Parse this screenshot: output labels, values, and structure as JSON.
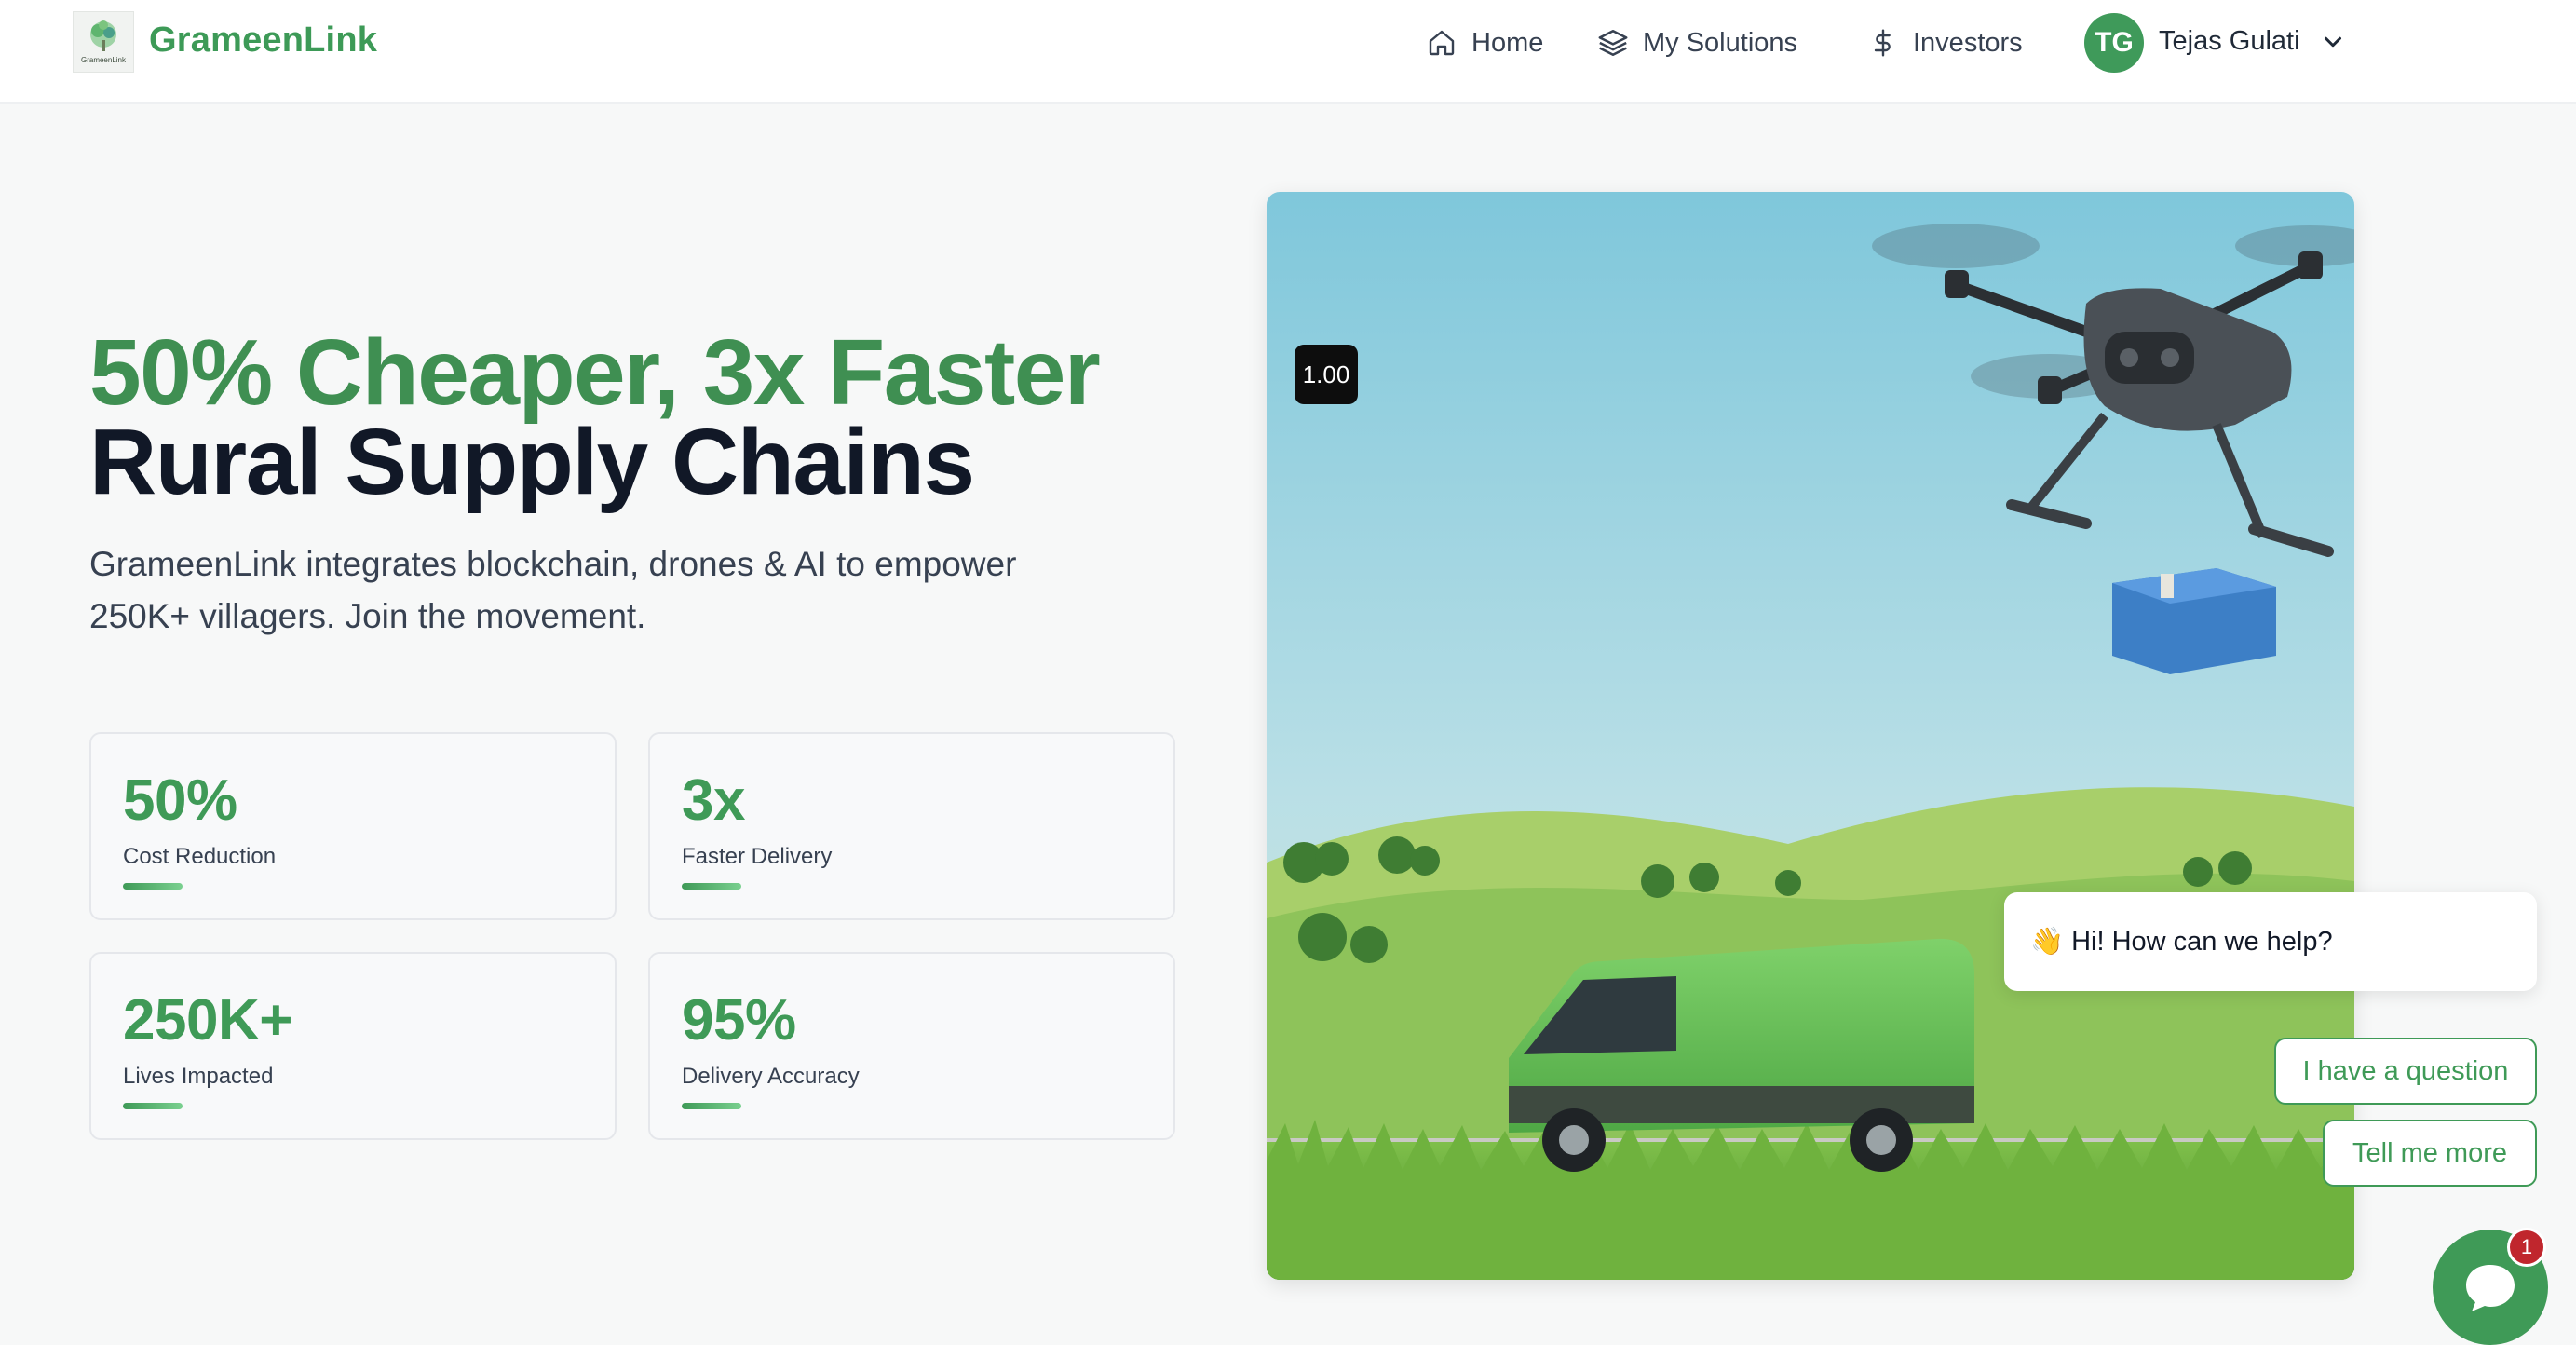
{
  "brand": {
    "logo_icon": "grameenlink-tree-logo",
    "logo_text": "GrameenLink",
    "name": "GrameenLink"
  },
  "nav": {
    "items": [
      {
        "label": "Home",
        "icon": "home-icon"
      },
      {
        "label": "My Solutions",
        "icon": "layers-icon"
      },
      {
        "label": "Investors",
        "icon": "dollar-icon"
      }
    ],
    "user": {
      "initials": "TG",
      "name": "Tejas Gulati",
      "menu_icon": "chevron-down-icon"
    }
  },
  "hero": {
    "title_line1": "50% Cheaper, 3x Faster",
    "title_line2": "Rural Supply Chains",
    "subtitle": "GrameenLink integrates blockchain, drones & AI to empower 250K+ villagers. Join the movement."
  },
  "stats": [
    {
      "value": "50%",
      "label": "Cost Reduction"
    },
    {
      "value": "3x",
      "label": "Faster Delivery"
    },
    {
      "value": "250K+",
      "label": "Lives Impacted"
    },
    {
      "value": "95%",
      "label": "Delivery Accuracy"
    }
  ],
  "media": {
    "badge": "1.00",
    "scene": "drone-carrying-package-over-green-van-in-fields"
  },
  "chat": {
    "greeting_emoji": "👋",
    "greeting": "Hi! How can we help?",
    "options": [
      "I have a question",
      "Tell me more"
    ],
    "unread_count": "1",
    "launcher_icon": "chat-icon"
  },
  "colors": {
    "brand_green": "#3f9a57",
    "heading_dark": "#111827",
    "badge_red": "#c0262d"
  }
}
